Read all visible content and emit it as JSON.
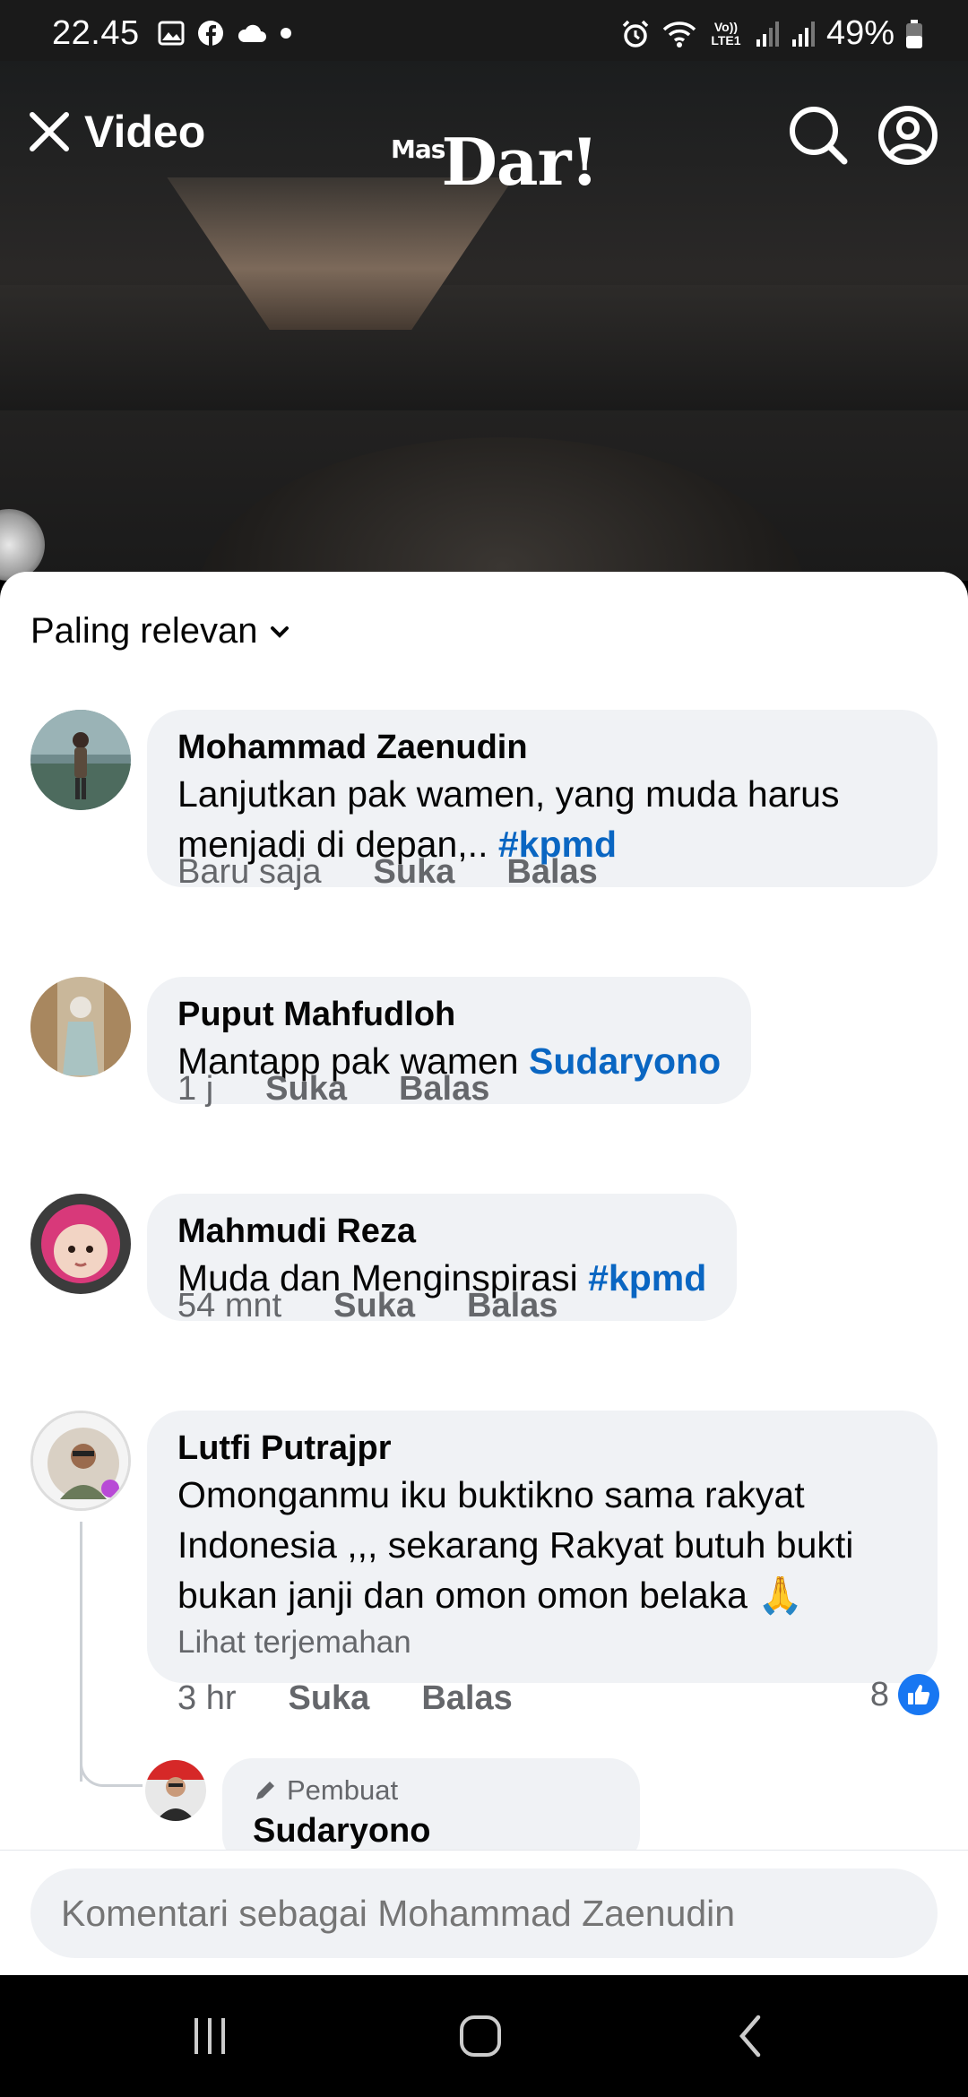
{
  "status_bar": {
    "time": "22.45",
    "battery": "49%",
    "left_icons": [
      "gallery-icon",
      "facebook-icon",
      "cloud-icon",
      "dot-icon"
    ],
    "right_icons": [
      "alarm-icon",
      "wifi-icon",
      "volte-icon",
      "signal-icon",
      "signal-icon",
      "battery-icon"
    ],
    "volte_label": "Vo)) LTE1"
  },
  "video_header": {
    "title": "Video",
    "brand_small": "Mas",
    "brand": "Dar!"
  },
  "comments": {
    "sort_label": "Paling relevan",
    "items": [
      {
        "name": "Mohammad Zaenudin",
        "text": "Lanjutkan pak wamen, yang muda harus menjadi di depan,.. ",
        "tag": "#kpmd",
        "time": "Baru saja",
        "like_label": "Suka",
        "reply_label": "Balas"
      },
      {
        "name": "Puput Mahfudloh",
        "text": "Mantapp pak wamen ",
        "tag": "Sudaryono",
        "time": "1 j",
        "like_label": "Suka",
        "reply_label": "Balas"
      },
      {
        "name": "Mahmudi Reza",
        "text": "Muda dan Menginspirasi ",
        "tag": "#kpmd",
        "time": "54 mnt",
        "like_label": "Suka",
        "reply_label": "Balas"
      },
      {
        "name": "Lutfi Putrajpr",
        "text": "Omonganmu iku buktikno sama rakyat Indonesia ,,, sekarang Rakyat butuh bukti bukan janji dan omon omon belaka 🙏",
        "translate": "Lihat terjemahan",
        "time": "3 hr",
        "like_label": "Suka",
        "reply_label": "Balas",
        "like_count": "8"
      }
    ],
    "reply": {
      "badge": "Pembuat",
      "name": "Sudaryono"
    }
  },
  "composer": {
    "placeholder": "Komentari sebagai Mohammad Zaenudin"
  },
  "colors": {
    "accent": "#0a66c2",
    "like_blue": "#1877f2",
    "bubble_bg": "#f0f2f5",
    "meta_gray": "#65676b"
  }
}
